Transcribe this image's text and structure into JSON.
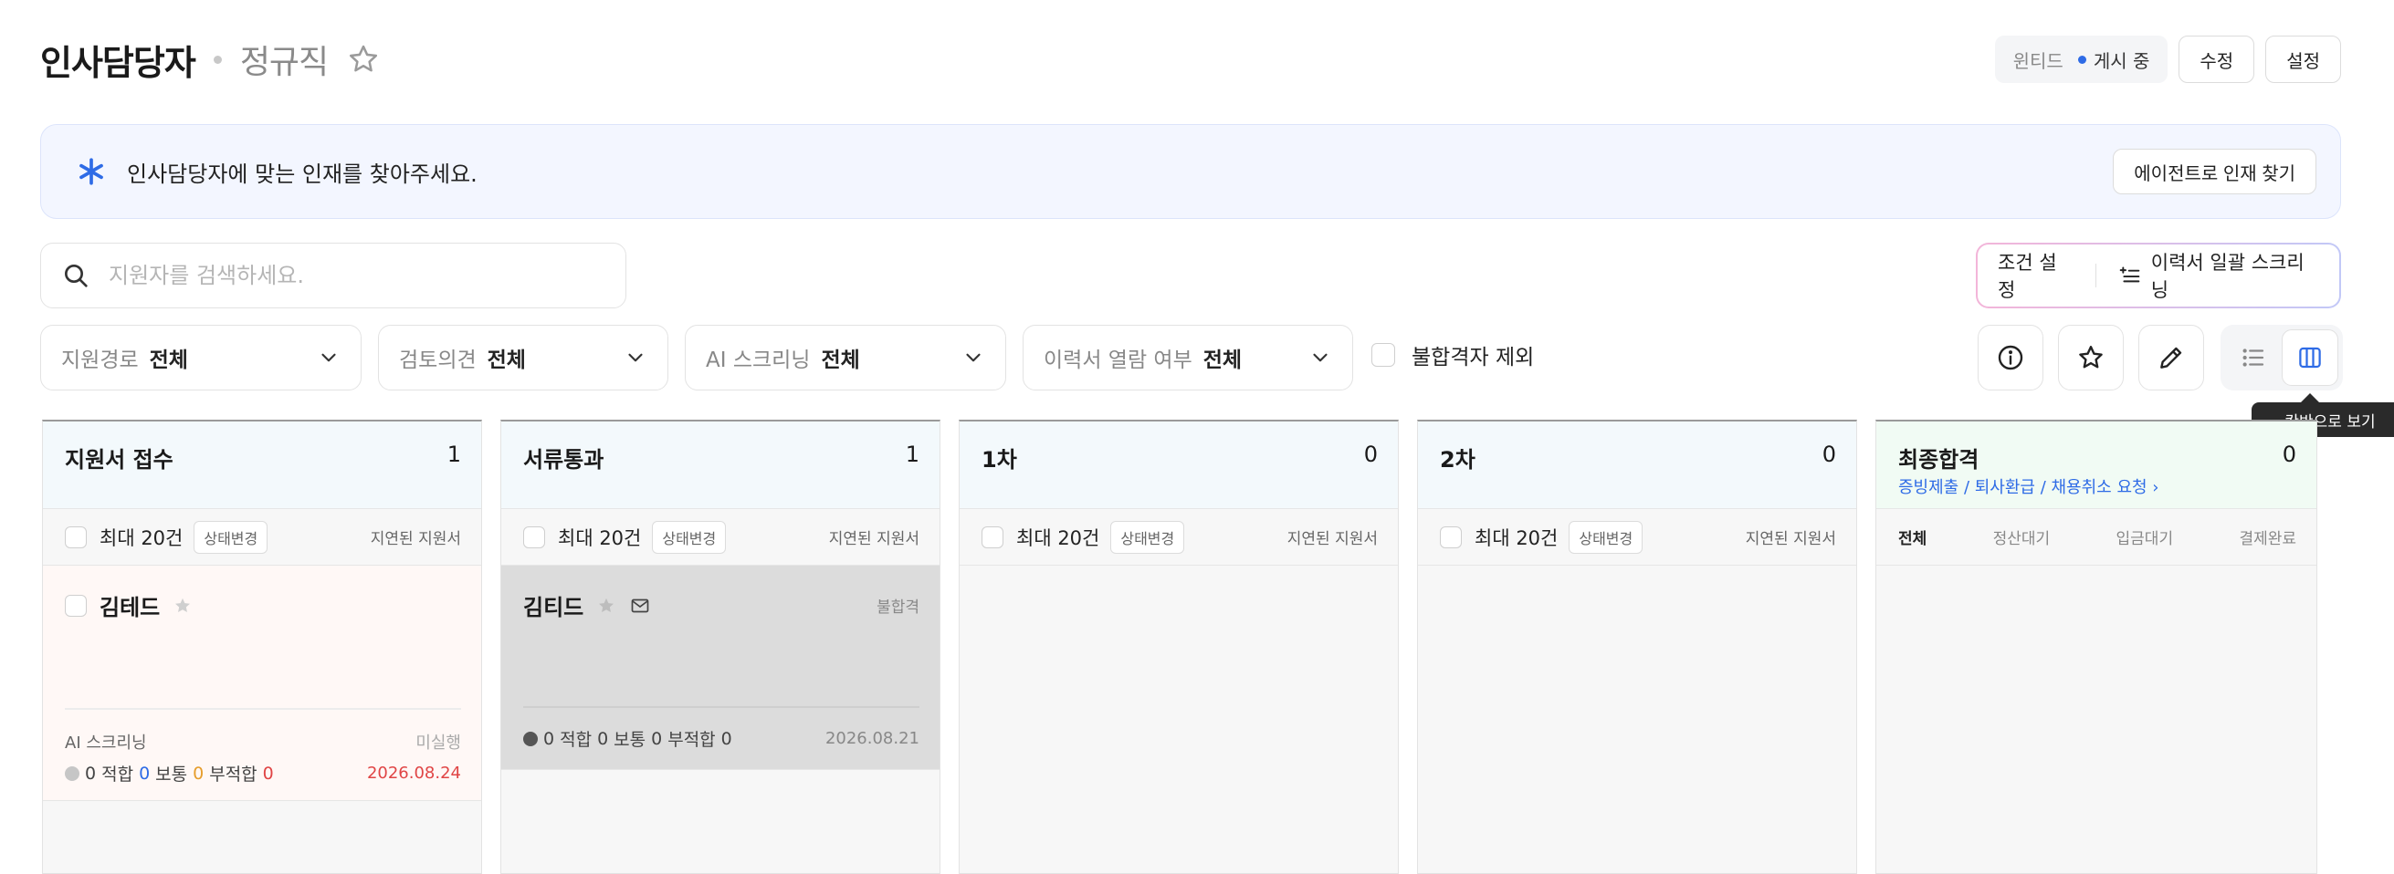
{
  "header": {
    "title": "인사담당자",
    "job_type": "정규직",
    "company": "윈티드",
    "status": "게시 중",
    "edit_label": "수정",
    "settings_label": "설정"
  },
  "banner": {
    "text": "인사담당자에 맞는 인재를 찾아주세요.",
    "button": "에이전트로 인재 찾기"
  },
  "search": {
    "placeholder": "지원자를 검색하세요.",
    "value": ""
  },
  "conditions": {
    "settings_label": "조건 설정",
    "bulk_label": "이력서 일괄 스크리닝"
  },
  "filters": [
    {
      "label": "지원경로",
      "value": "전체"
    },
    {
      "label": "검토의견",
      "value": "전체"
    },
    {
      "label": "AI 스크리닝",
      "value": "전체"
    },
    {
      "label": "이력서 열람 여부",
      "value": "전체"
    }
  ],
  "exclude_rejected": "불합격자 제외",
  "tooltip": "칸반으로 보기",
  "columns": [
    {
      "title": "지원서 접수",
      "count": "1",
      "max": "최대 20건",
      "tag": "상태변경",
      "delay": "지연된 지원서",
      "card": {
        "name": "김테드",
        "ai_label": "AI 스크리닝",
        "ai_status": "미실행",
        "score_total": "0",
        "fit_label": "적합",
        "fit": "0",
        "normal_label": "보통",
        "normal": "0",
        "unfit_label": "부적합",
        "unfit": "0",
        "date": "2026.08.24"
      }
    },
    {
      "title": "서류통과",
      "count": "1",
      "max": "최대 20건",
      "tag": "상태변경",
      "delay": "지연된 지원서",
      "card": {
        "name": "김티드",
        "badge": "불합격",
        "score_total": "0",
        "fit_label": "적합",
        "fit": "0",
        "normal_label": "보통",
        "normal": "0",
        "unfit_label": "부적합",
        "unfit": "0",
        "date": "2026.08.21"
      }
    },
    {
      "title": "1차",
      "count": "0",
      "max": "최대 20건",
      "tag": "상태변경",
      "delay": "지연된 지원서"
    },
    {
      "title": "2차",
      "count": "0",
      "max": "최대 20건",
      "tag": "상태변경",
      "delay": "지연된 지원서"
    },
    {
      "title": "최종합격",
      "count": "0",
      "link": "증빙제출 / 퇴사환급 / 채용취소 요청",
      "tabs": [
        "전체",
        "정산대기",
        "입금대기",
        "결제완료"
      ]
    }
  ],
  "colors": {
    "accent": "#2e6be6",
    "danger": "#e04545",
    "warning": "#e69d2c"
  }
}
